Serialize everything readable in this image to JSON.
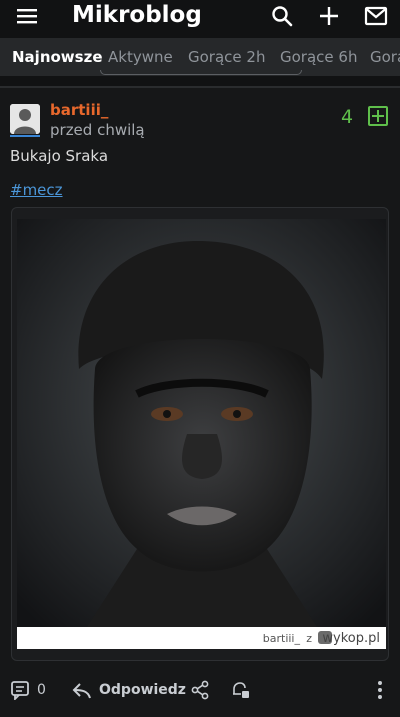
{
  "app": {
    "title": "Mikroblog"
  },
  "tabs": [
    {
      "label": "Najnowsze",
      "active": true
    },
    {
      "label": "Aktywne",
      "active": false
    },
    {
      "label": "Gorące 2h",
      "active": false
    },
    {
      "label": "Gorące 6h",
      "active": false
    },
    {
      "label": "Gorą",
      "active": false
    }
  ],
  "post": {
    "author": "bartiii_",
    "time": "przed chwilą",
    "votes": "4",
    "text": "Bukajo Sraka",
    "hashtag": "#mecz",
    "image": {
      "watermark_user": "bartiii_",
      "watermark_z": "z",
      "watermark_site": "wykop.pl"
    }
  },
  "actions": {
    "comments_count": "0",
    "reply_label": "Odpowiedz"
  },
  "icons": {
    "menu": "menu-icon",
    "search": "search-icon",
    "add": "plus-icon",
    "messages": "envelope-icon",
    "comments": "comment-icon",
    "reply": "reply-arrow-icon",
    "share": "share-icon",
    "notify": "bell-add-icon",
    "more": "kebab-menu-icon"
  },
  "colors": {
    "author": "#e8682c",
    "upvote": "#5fbf4b",
    "hashtag": "#4b96d8",
    "background": "#111213"
  }
}
